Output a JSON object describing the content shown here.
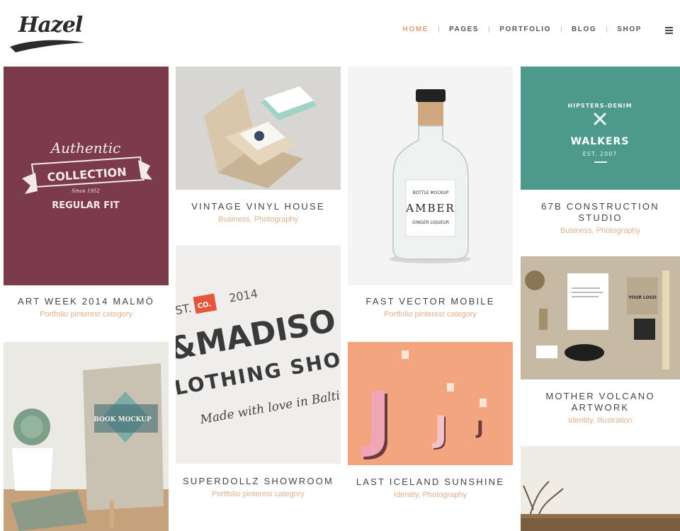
{
  "brand": {
    "logo_text": "Hazel"
  },
  "nav": {
    "items": [
      {
        "label": "HOME",
        "active": true
      },
      {
        "label": "PAGES",
        "active": false
      },
      {
        "label": "PORTFOLIO",
        "active": false
      },
      {
        "label": "BLOG",
        "active": false
      },
      {
        "label": "SHOP",
        "active": false
      }
    ],
    "menu_icon": "hamburger-icon"
  },
  "colors": {
    "accent": "#d9a27c",
    "maroon": "#7c3a4d",
    "teal": "#4a9a8b",
    "peach": "#f2a27c",
    "sub_text": "#e0b08f"
  },
  "portfolio": [
    {
      "title": "ART WEEK 2014 MALMÖ",
      "subtitle": "Portfolio pinterest category",
      "art": {
        "line1": "Authentic",
        "line2": "COLLECTION",
        "line3": "Since 1952",
        "line4": "REGULAR FIT"
      }
    },
    {
      "title": "VINTAGE VINYL HOUSE",
      "subtitle": "Business, Photography"
    },
    {
      "title": "FAST VECTOR MOBILE",
      "subtitle": "Portfolio pinterest category",
      "art": {
        "line1": "BOTTLE MOCKUP",
        "line2": "AMBER",
        "line3": "GINGER LIQUEUR"
      }
    },
    {
      "title": "67B CONSTRUCTION STUDIO",
      "subtitle": "Business, Photography",
      "art": {
        "line1": "HIPSTERS-DENIM",
        "line2": "WALKERS",
        "line3": "EST. 2007"
      }
    },
    {
      "title": "SUPERDOLLZ SHOWROOM",
      "subtitle": "Portfolio pinterest category",
      "art": {
        "line1": "EST.",
        "line2": "2014",
        "line3": "CO.",
        "line4": "&MADISO",
        "line5": "LOTHING SHO",
        "line6": "Made with love in Baltimore"
      }
    },
    {
      "title": "LAST ICELAND SUNSHINE",
      "subtitle": "Identity, Photography",
      "art": {
        "letter": "J"
      }
    },
    {
      "title": "MOTHER VOLCANO ARTWORK",
      "subtitle": "Identity, Illustration",
      "art": {
        "line1": "YOUR LOGO"
      }
    },
    {
      "title": "",
      "subtitle": "",
      "art": {
        "line1": "BOOK MOCKUP"
      }
    }
  ]
}
